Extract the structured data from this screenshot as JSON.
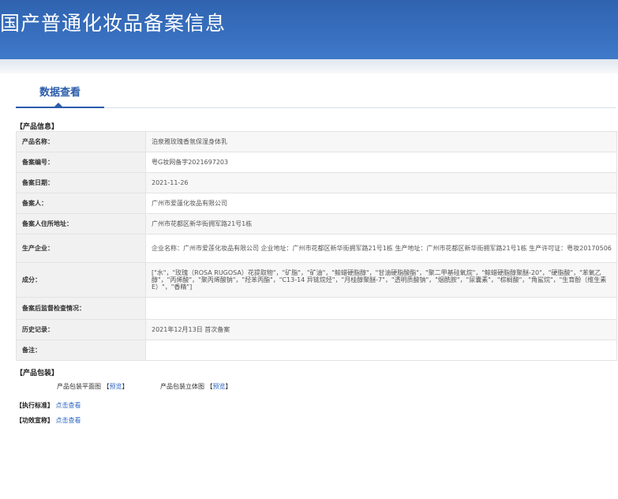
{
  "header": {
    "title": "国产普通化妆品备案信息"
  },
  "tab": {
    "label": "数据查看"
  },
  "product_info": {
    "section": "【产品信息】",
    "rows": [
      {
        "key": "产品名称：",
        "value": "泊泉雅玫瑰香氛保湿身体乳"
      },
      {
        "key": "备案编号：",
        "value": "粤G妆网备字2021697203"
      },
      {
        "key": "备案日期：",
        "value": "2021-11-26"
      },
      {
        "key": "备案人：",
        "value": "广州市爱蓮化妆品有限公司"
      },
      {
        "key": "备案人住所地址：",
        "value": "广州市花都区新华街拥军路21号1栋"
      },
      {
        "key": "生产企业：",
        "value": "企业名称：广州市爱莲化妆品有限公司 企业地址：广州市花都区新华街拥军路21号1栋 生产地址：广州市花都区新华街拥军路21号1栋 生产许可证：粤妆20170506"
      },
      {
        "key": "成分：",
        "value": "[\"水\"，\"玫瑰（ROSA RUGOSA）花提取物\"，\"矿脂\"，\"矿油\"，\"鲸蜡硬脂醇\"，\"甘油硬脂酸酯\"，\"聚二甲基硅氧烷\"，\"鲸蜡硬脂醇聚醚-20\"，\"硬脂酸\"，\"苯氧乙醇\"，\"丙烯酸\"，\"聚丙烯酸钠\"，\"羟苯丙酯\"，\"C13-14 异链烷烃\"，\"月桂醇聚醚-7\"，\"透明质酸钠\"，\"烟酰胺\"，\"尿囊素\"，\"棕榈酸\"，\"角鲨烷\"，\"生育酚（维生素E）\"，\"香精\"]"
      },
      {
        "key": "备案后监督检查情况：",
        "value": ""
      },
      {
        "key": "历史记录：",
        "value": "2021年12月13日 首次备案"
      },
      {
        "key": "备注：",
        "value": ""
      }
    ]
  },
  "packaging": {
    "section": "【产品包装】",
    "flat_label": "产品包装平面图",
    "flat_link_open": "【",
    "flat_link": "预览",
    "flat_link_close": "】",
    "solid_label": "产品包装立体图",
    "solid_link_open": "【",
    "solid_link": "预览",
    "solid_link_close": "】"
  },
  "standard": {
    "label": "【执行标准】",
    "link": "点击查看"
  },
  "efficacy": {
    "label": "【功效宣称】",
    "link": "点击查看"
  }
}
